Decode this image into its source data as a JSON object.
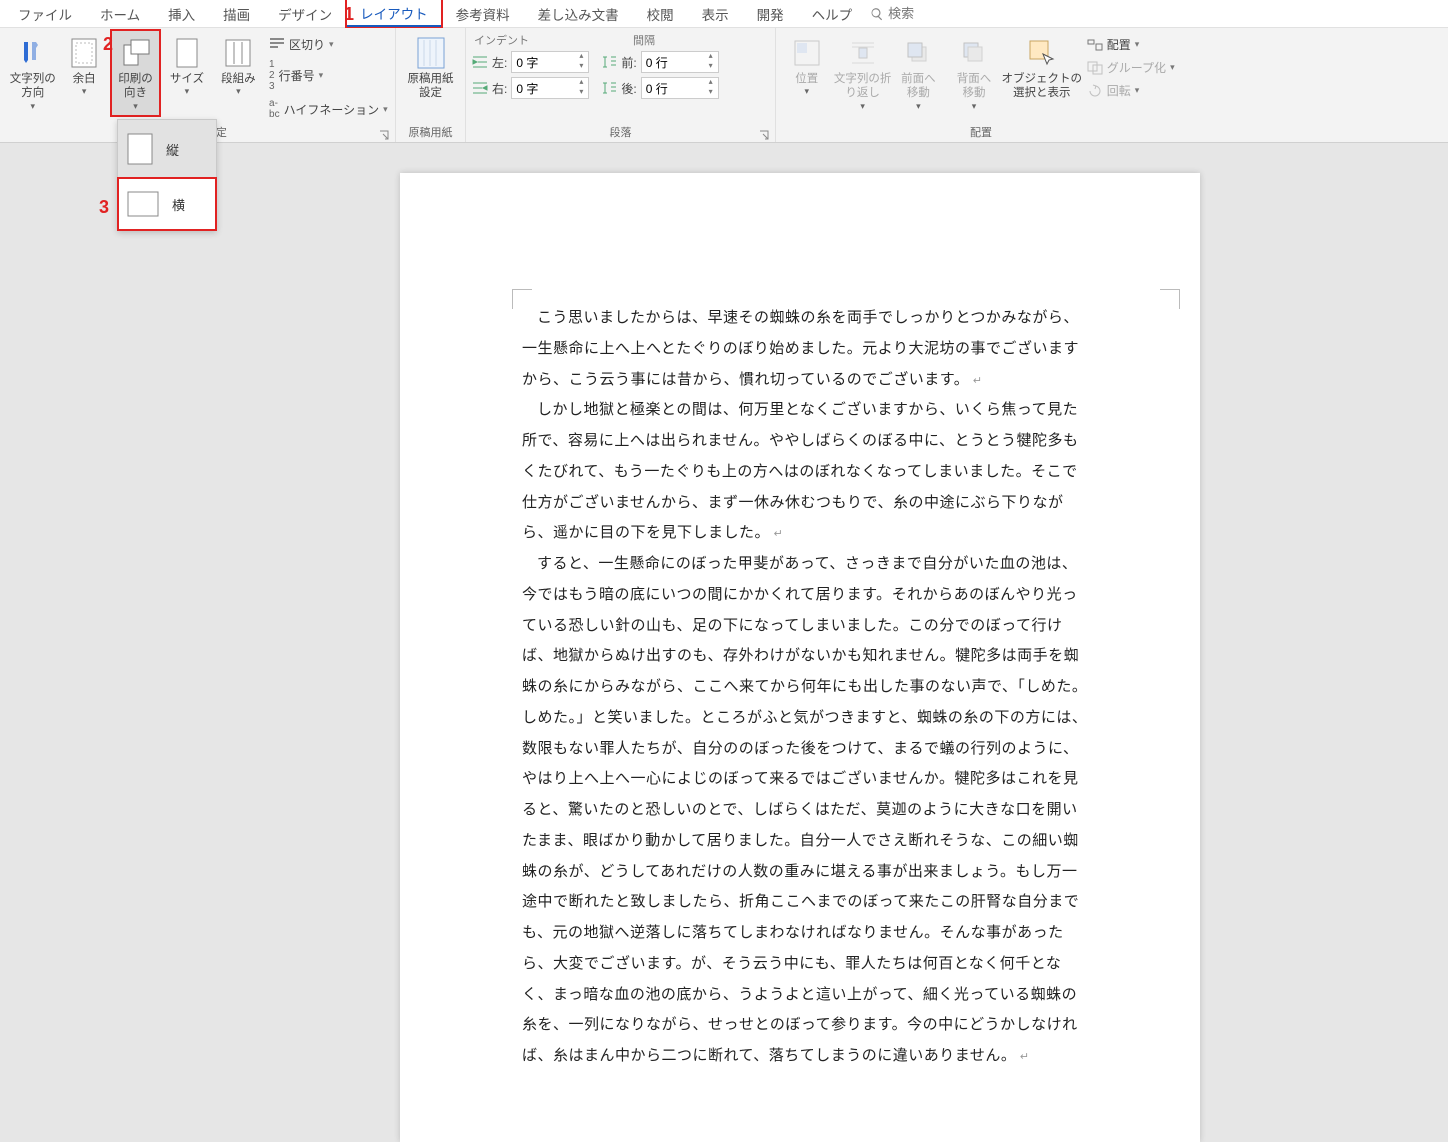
{
  "tabs": {
    "file": "ファイル",
    "home": "ホーム",
    "insert": "挿入",
    "draw": "描画",
    "design": "デザイン",
    "layout": "レイアウト",
    "refs": "参考資料",
    "mail": "差し込み文書",
    "review": "校閲",
    "view": "表示",
    "dev": "開発",
    "help": "ヘルプ"
  },
  "search": {
    "placeholder": "検索"
  },
  "annotations": {
    "n1": "1",
    "n2": "2",
    "n3": "3"
  },
  "ribbon": {
    "pageSetup": {
      "label": "ページ設定",
      "textDir": "文字列の\n方向",
      "margins": "余白",
      "orient": "印刷の\n向き",
      "size": "サイズ",
      "columns": "段組み",
      "breaks": "区切り",
      "lineNum": "行番号",
      "hyphen": "ハイフネーション"
    },
    "genko": {
      "label": "原稿用紙",
      "settings": "原稿用紙\n設定"
    },
    "paragraph": {
      "label": "段落",
      "indent": "インデント",
      "spacing": "間隔",
      "left": "左:",
      "right": "右:",
      "before": "前:",
      "after": "後:",
      "leftVal": "0 字",
      "rightVal": "0 字",
      "beforeVal": "0 行",
      "afterVal": "0 行"
    },
    "arrange": {
      "label": "配置",
      "pos": "位置",
      "wrap": "文字列の折\nり返し",
      "front": "前面へ\n移動",
      "back": "背面へ\n移動",
      "selpane": "オブジェクトの\n選択と表示",
      "align": "配置",
      "group": "グループ化",
      "rotate": "回転"
    }
  },
  "orientMenu": {
    "portrait": "縦",
    "landscape": "横"
  },
  "document": {
    "p1": "こう思いましたからは、早速その蜘蛛の糸を両手でしっかりとつかみながら、一生懸命に上へ上へとたぐりのぼり始めました。元より大泥坊の事でございますから、こう云う事には昔から、慣れ切っているのでございます。",
    "p2": "しかし地獄と極楽との間は、何万里となくございますから、いくら焦って見た所で、容易に上へは出られません。ややしばらくのぼる中に、とうとう犍陀多もくたびれて、もう一たぐりも上の方へはのぼれなくなってしまいました。そこで仕方がございませんから、まず一休み休むつもりで、糸の中途にぶら下りながら、遥かに目の下を見下しました。",
    "p3": "すると、一生懸命にのぼった甲斐があって、さっきまで自分がいた血の池は、今ではもう暗の底にいつの間にかかくれて居ります。それからあのぼんやり光っている恐しい針の山も、足の下になってしまいました。この分でのぼって行けば、地獄からぬけ出すのも、存外わけがないかも知れません。犍陀多は両手を蜘蛛の糸にからみながら、ここへ来てから何年にも出した事のない声で、「しめた。しめた。」と笑いました。ところがふと気がつきますと、蜘蛛の糸の下の方には、数限もない罪人たちが、自分ののぼった後をつけて、まるで蟻の行列のように、やはり上へ上へ一心によじのぼって来るではございませんか。犍陀多はこれを見ると、驚いたのと恐しいのとで、しばらくはただ、莫迦のように大きな口を開いたまま、眼ばかり動かして居りました。自分一人でさえ断れそうな、この細い蜘蛛の糸が、どうしてあれだけの人数の重みに堪える事が出来ましょう。もし万一途中で断れたと致しましたら、折角ここへまでのぼって来たこの肝腎な自分までも、元の地獄へ逆落しに落ちてしまわなければなりません。そんな事があったら、大変でございます。が、そう云う中にも、罪人たちは何百となく何千となく、まっ暗な血の池の底から、うようよと這い上がって、細く光っている蜘蛛の糸を、一列になりながら、せっせとのぼって参ります。今の中にどうかしなければ、糸はまん中から二つに断れて、落ちてしまうのに違いありません。"
  }
}
